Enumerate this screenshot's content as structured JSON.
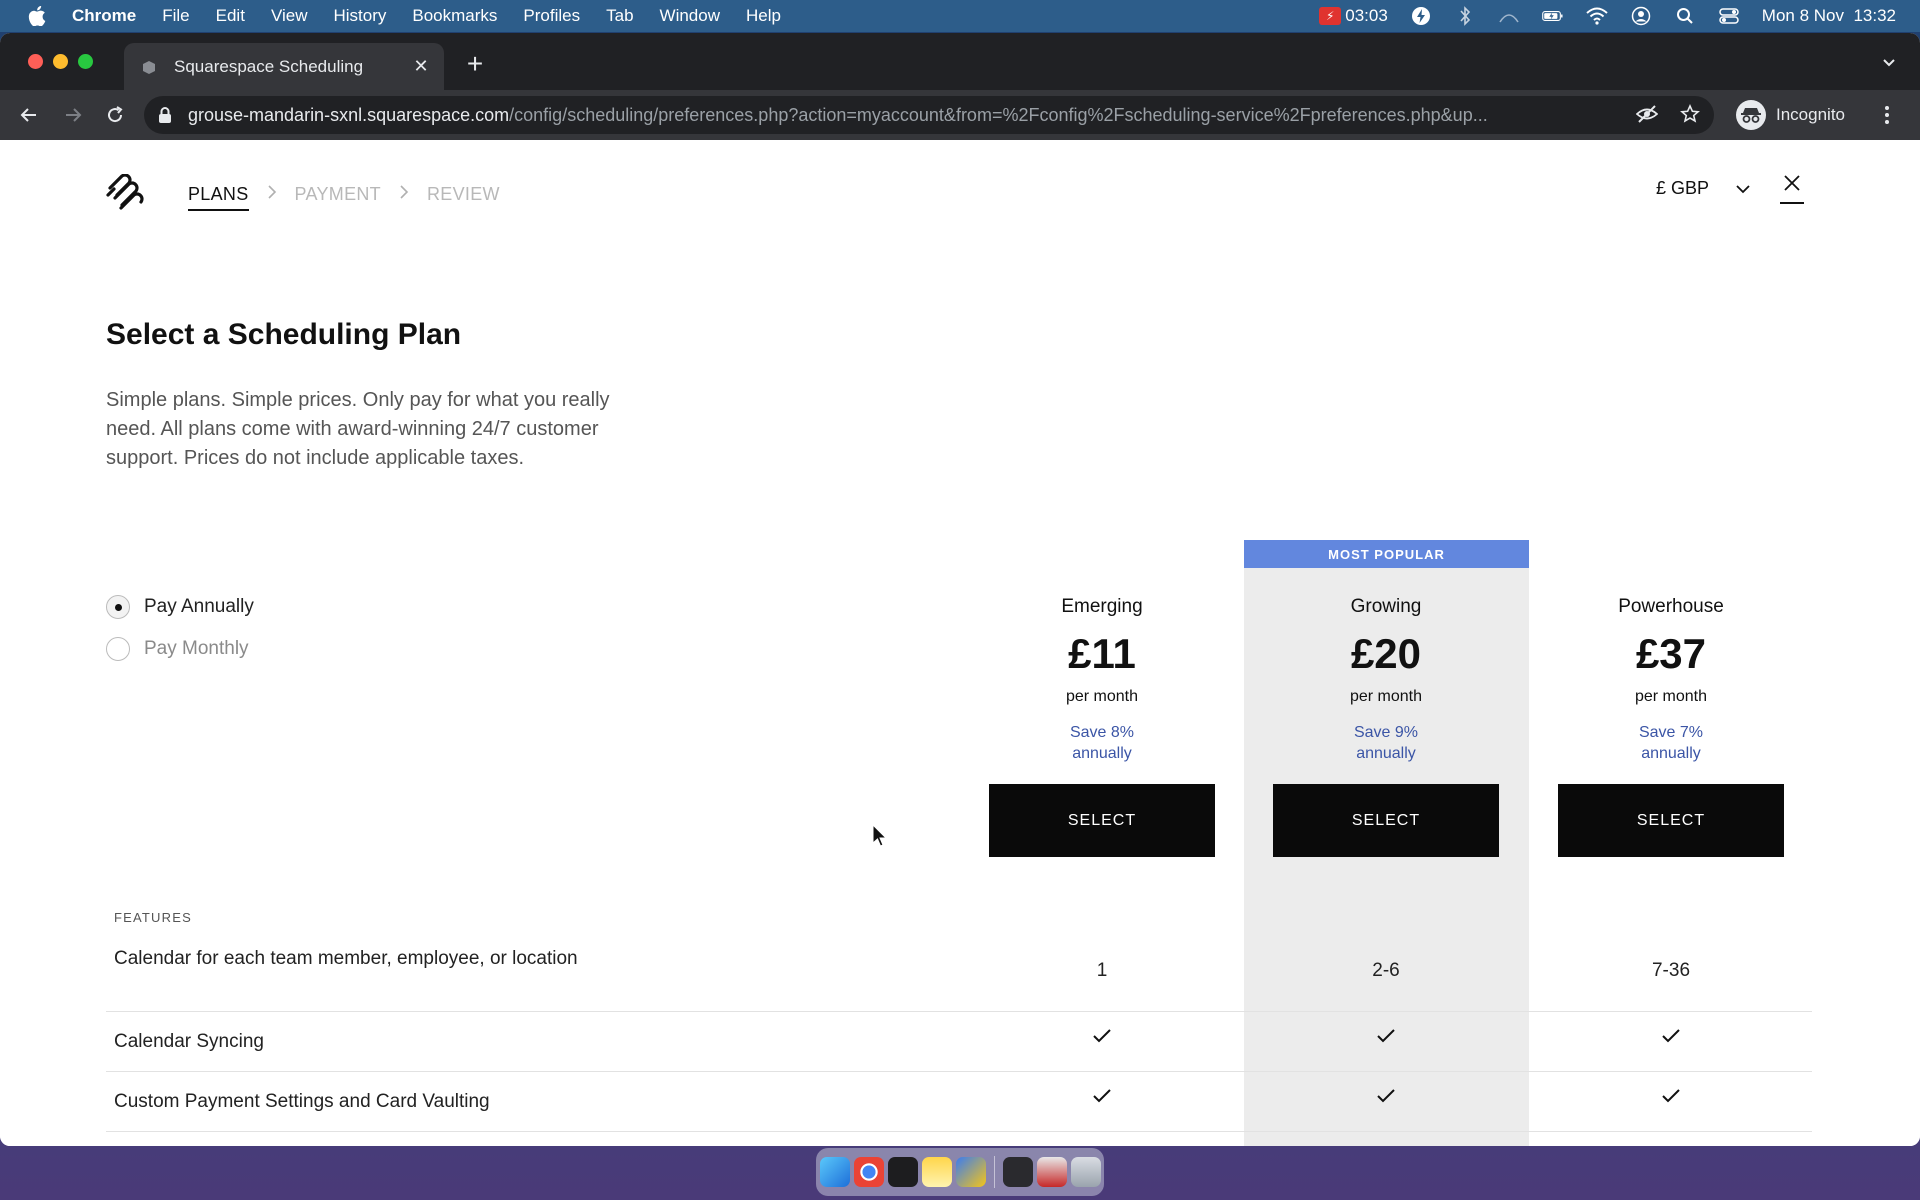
{
  "menubar": {
    "app_name": "Chrome",
    "menus": [
      "File",
      "Edit",
      "View",
      "History",
      "Bookmarks",
      "Profiles",
      "Tab",
      "Window",
      "Help"
    ],
    "timer": "03:03",
    "datetime": "Mon 8 Nov  13:32"
  },
  "browser": {
    "tab_title": "Squarespace Scheduling",
    "url_host": "grouse-mandarin-sxnl.squarespace.com",
    "url_path": "/config/scheduling/preferences.php?action=myaccount&from=%2Fconfig%2Fscheduling-service%2Fpreferences.php&up...",
    "profile_label": "Incognito"
  },
  "header": {
    "steps": [
      "PLANS",
      "PAYMENT",
      "REVIEW"
    ],
    "currency": "£ GBP"
  },
  "main": {
    "title": "Select a Scheduling Plan",
    "intro": "Simple plans. Simple prices. Only pay for what you really need. All plans come with award-winning 24/7 customer support. Prices do not include applicable taxes.",
    "billing_options": [
      {
        "label": "Pay Annually",
        "selected": true
      },
      {
        "label": "Pay Monthly",
        "selected": false
      }
    ],
    "popular_badge": "MOST POPULAR",
    "plans": [
      {
        "name": "Emerging",
        "price": "£11",
        "period": "per month",
        "save_line1": "Save 8%",
        "save_line2": "annually",
        "button": "SELECT"
      },
      {
        "name": "Growing",
        "price": "£20",
        "period": "per month",
        "save_line1": "Save 9%",
        "save_line2": "annually",
        "button": "SELECT"
      },
      {
        "name": "Powerhouse",
        "price": "£37",
        "period": "per month",
        "save_line1": "Save 7%",
        "save_line2": "annually",
        "button": "SELECT"
      }
    ],
    "features_label": "FEATURES",
    "features": [
      {
        "name": "Calendar for each team member, employee, or location",
        "values": [
          "1",
          "2-6",
          "7-36"
        ]
      },
      {
        "name": "Calendar Syncing",
        "values": [
          "check",
          "check",
          "check"
        ]
      },
      {
        "name": "Custom Payment Settings and Card Vaulting",
        "values": [
          "check",
          "check",
          "check"
        ]
      }
    ]
  },
  "colors": {
    "accent": "#6287de",
    "save_text": "#3b55a6",
    "button_bg": "#0a0a0a",
    "popular_column": "#ececec"
  },
  "icons": {
    "logo": "squarespace-logo-icon",
    "close": "close-icon",
    "currency_toggle": "chevron-down-icon",
    "check": "check-icon"
  }
}
